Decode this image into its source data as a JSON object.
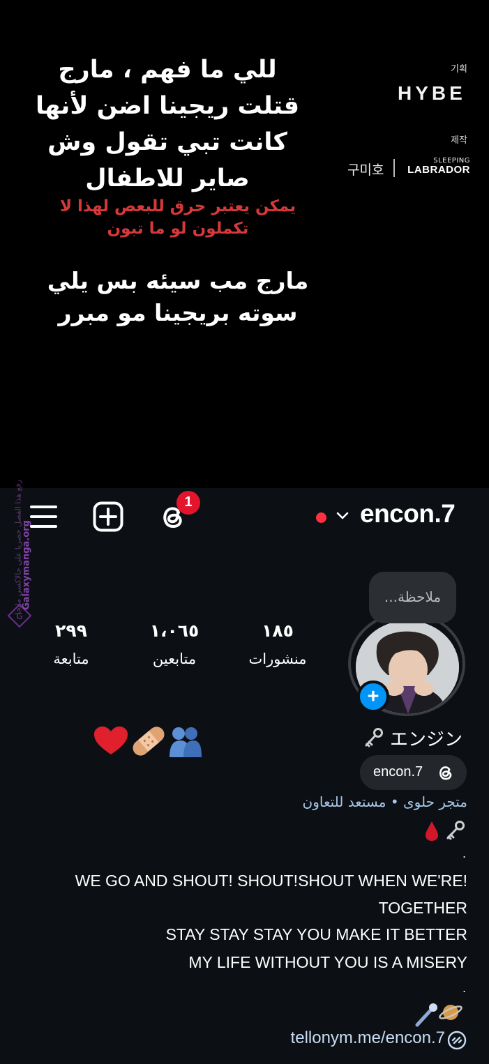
{
  "caption": {
    "white_text": "للي ما فهم ، مارج قتلت ريجينا اضن لأنها كانت تبي تقول وش صاير للاطفال",
    "red_warning": "يمكن يعتبر حرق للبعص لهذا لا تكملون لو ما تبون",
    "white_text_2": "مارج مب سيئه بس يلي سوته بريجينا مو مبرر"
  },
  "credits": {
    "plan_label": "기획",
    "plan_company": "HYBE",
    "production_label": "제작",
    "studio_1": "구미호",
    "studio_2_top": "SLEEPING",
    "studio_2_bottom": "LABRADOR"
  },
  "watermark": {
    "site": "Galaxymanga.org",
    "text": "رفع هذا الفصل حصريا على جالاكسي مانجا"
  },
  "profile_header": {
    "username": "encon.7",
    "notification_count": "1",
    "icons": [
      "menu-icon",
      "add-icon",
      "threads-icon",
      "chevron-down-icon"
    ],
    "live_dot_color": "#ff3040"
  },
  "profile": {
    "note_placeholder": "ملاحظة...",
    "stats": {
      "posts_count": "١٨٥",
      "posts_label": "منشورات",
      "followers_count": "١،٠٦٥",
      "followers_label": "متابعين",
      "following_count": "٢٩٩",
      "following_label": "متابعة"
    },
    "display_name": "エンジン",
    "threads_handle": "encon.7",
    "category": "متجر حلوى • مستعد للتعاون",
    "bio_lines": [
      ".",
      "WE GO AND SHOUT! SHOUT!SHOUT WHEN WE'RE!",
      "TOGETHER",
      "STAY STAY STAY YOU MAKE IT BETTER",
      "MY LIFE WITHOUT YOU IS  A MISERY",
      "."
    ],
    "bio_link": "tellonym.me/encon.7",
    "accent_color": "#0095f6"
  }
}
